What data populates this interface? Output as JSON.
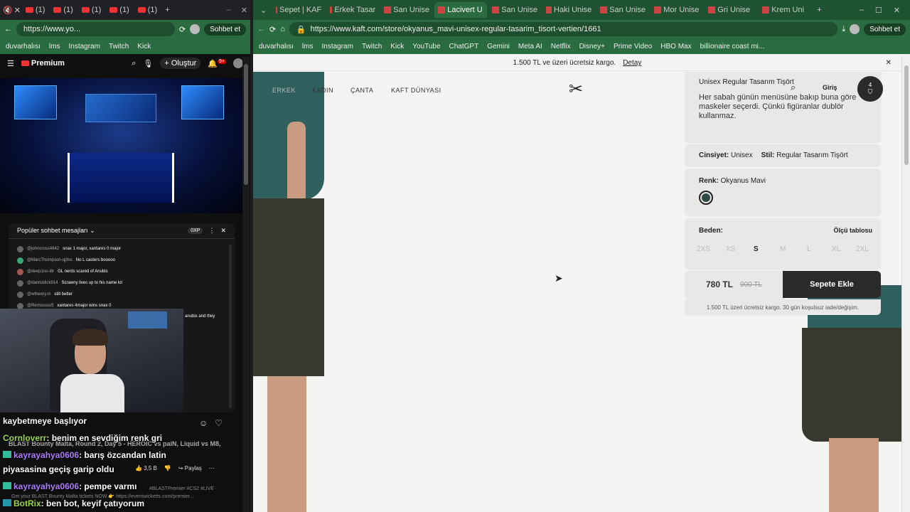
{
  "left_browser": {
    "tabs": [
      "(1)",
      "(1)",
      "(1)",
      "(1)",
      "(1)"
    ],
    "url": "https://www.yo...",
    "copilot": "Sohbet et",
    "bookmarks": [
      "duvarhalısı",
      "lms",
      "Instagram",
      "Twitch",
      "Kick"
    ],
    "youtube": {
      "logo": "Premium",
      "create": "Oluştur",
      "notif_count": "9+",
      "chat": {
        "header": "Popüler sohbet mesajları",
        "points": "0XP",
        "messages": [
          {
            "user": "@johncross4642",
            "text": "snax 1 major, xantares 0 major"
          },
          {
            "user": "@MarcThompson-qj9ss",
            "text": "No L casters booooo"
          },
          {
            "user": "@deep1no-i8r",
            "text": "GL nerds scared of Anubis"
          },
          {
            "user": "@danriddick914",
            "text": "Scrawny lives up to his name lol"
          },
          {
            "user": "@wtheory.m",
            "text": "still better"
          },
          {
            "user": "@Remossss5",
            "text": "xantares 4major wins snax 0"
          }
        ],
        "partial_message": "anubis and they"
      },
      "video_title": "BLAST Bounty Malta, Round 2, Day 5 - HEROIC vs paiN, Liquid vs M8,",
      "likes": "3,5 B",
      "share": "Paylaş",
      "description": "Get your BLAST Bounty Malta tickets NOW 👉 https://eventwicketts.com/premier...",
      "hashtags": "#BLASTPremier #CS2 #LIVE"
    },
    "overlay_chat": [
      {
        "user": "",
        "text": "kaybetmeye başlıyor",
        "color": "#ffffff"
      },
      {
        "user": "Cornloverr",
        "text": ": benim en sevdiğim renk gri",
        "color": "#9bd84a"
      },
      {
        "user": "kayrayahya0606",
        "text": ": barış özcandan latin",
        "color": "#b07bff"
      },
      {
        "user": "",
        "text": "piyasasina geçiş garip oldu",
        "color": "#ffffff"
      },
      {
        "user": "kayrayahya0606",
        "text": ": pempe varmı",
        "color": "#b07bff"
      },
      {
        "user": "BotRix",
        "text": ": ben bot, keyif çatıyorum",
        "color": "#9bd84a"
      }
    ]
  },
  "right_browser": {
    "tabs": [
      {
        "label": "Sepet | KAF"
      },
      {
        "label": "Erkek Tasar"
      },
      {
        "label": "San Unise"
      },
      {
        "label": "Lacivert U"
      },
      {
        "label": "San Unise"
      },
      {
        "label": "Haki Unise"
      },
      {
        "label": "San Unise"
      },
      {
        "label": "Mor Unise"
      },
      {
        "label": "Gri Unise"
      },
      {
        "label": "Krem Uni"
      }
    ],
    "active_tab": 3,
    "url": "https://www.kaft.com/store/okyanus_mavi-unisex-regular-tasarim_tisort-vertien/1661",
    "copilot": "Sohbet et",
    "bookmarks": [
      "duvarhalısı",
      "lms",
      "Instagram",
      "Twitch",
      "Kick",
      "YouTube",
      "ChatGPT",
      "Gemini",
      "Meta AI",
      "Netflix",
      "Disney+",
      "Prime Video",
      "HBO Max",
      "billionaire coast mi..."
    ]
  },
  "kaft": {
    "promo": "1.500 TL ve üzeri ücretsiz kargo.",
    "promo_link": "Detay",
    "nav": [
      "ERKEK",
      "KADIN",
      "ÇANTA",
      "KAFT DÜNYASI"
    ],
    "login": "Giriş",
    "cart_count": "4",
    "product_title": "Unisex Regular Tasarım Tişört",
    "product_desc": "Her sabah günün menüsüne bakıp buna göre maskeler seçerdi. Çünkü figüranlar dublör kullanmaz.",
    "gender_label": "Cinsiyet:",
    "gender_value": "Unisex",
    "style_label": "Stil:",
    "style_value": "Regular Tasarım Tişört",
    "color_label": "Renk:",
    "color_value": "Okyanus Mavi",
    "swatch_color": "#2f4a46",
    "size_label": "Beden:",
    "size_chart": "Ölçü tablosu",
    "sizes": [
      "2XS",
      "XS",
      "S",
      "M",
      "L",
      "XL",
      "2XL"
    ],
    "selected_size": "S",
    "price": "780 TL",
    "old_price": "900 TL",
    "add_to_cart": "Sepete Ekle",
    "shipping_note": "1.500 TL üzeri ücretsiz kargo. 30 gün koşulsuz iade/değişim."
  }
}
